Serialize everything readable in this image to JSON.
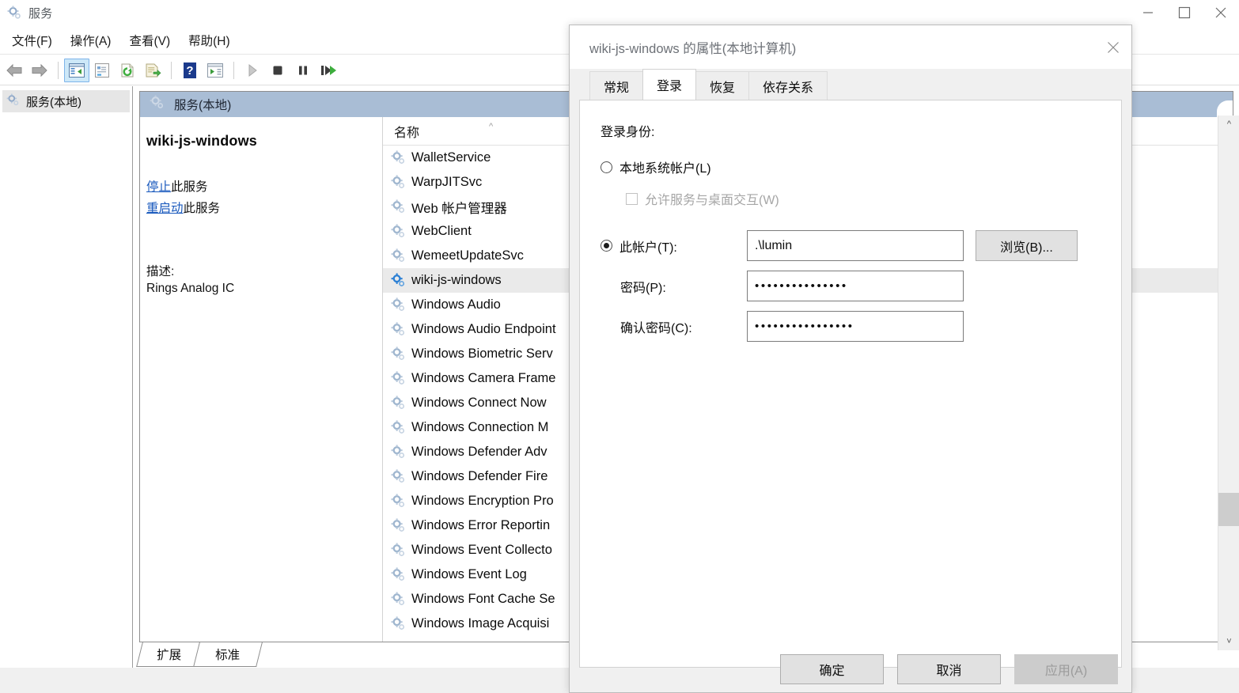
{
  "window": {
    "title": "服务",
    "icon": "services-gear-icon",
    "controls": {
      "minimize": "minimize-icon",
      "maximize": "maximize-icon",
      "close": "close-icon"
    }
  },
  "menubar": {
    "items": [
      {
        "label": "文件(F)",
        "name": "menu-file"
      },
      {
        "label": "操作(A)",
        "name": "menu-action"
      },
      {
        "label": "查看(V)",
        "name": "menu-view"
      },
      {
        "label": "帮助(H)",
        "name": "menu-help"
      }
    ]
  },
  "toolbar": {
    "buttons": [
      {
        "name": "back-icon"
      },
      {
        "name": "forward-icon"
      },
      {
        "name": "show-hide-console-tree-icon"
      },
      {
        "name": "properties-icon"
      },
      {
        "name": "refresh-icon"
      },
      {
        "name": "export-list-icon"
      },
      {
        "name": "help-icon"
      },
      {
        "name": "show-hide-action-pane-icon"
      },
      {
        "name": "start-service-icon"
      },
      {
        "name": "stop-service-icon"
      },
      {
        "name": "pause-service-icon"
      },
      {
        "name": "restart-service-icon"
      }
    ]
  },
  "tree": {
    "root_label": "服务(本地)"
  },
  "pane": {
    "header_title": "服务(本地)"
  },
  "detail": {
    "service_name": "wiki-js-windows",
    "stop_link": "停止",
    "stop_suffix": "此服务",
    "restart_link": "重启动",
    "restart_suffix": "此服务",
    "description_label": "描述:",
    "description_text": "Rings Analog IC"
  },
  "list": {
    "column_header": "名称",
    "sort_indicator": "ascending",
    "rows": [
      {
        "label": "WalletService",
        "selected": false
      },
      {
        "label": "WarpJITSvc",
        "selected": false
      },
      {
        "label": "Web 帐户管理器",
        "selected": false
      },
      {
        "label": "WebClient",
        "selected": false
      },
      {
        "label": "WemeetUpdateSvc",
        "selected": false
      },
      {
        "label": "wiki-js-windows",
        "selected": true
      },
      {
        "label": "Windows Audio",
        "selected": false
      },
      {
        "label": "Windows Audio Endpoint",
        "selected": false
      },
      {
        "label": "Windows Biometric Serv",
        "selected": false
      },
      {
        "label": "Windows Camera Frame",
        "selected": false
      },
      {
        "label": "Windows Connect Now",
        "selected": false
      },
      {
        "label": "Windows Connection M",
        "selected": false
      },
      {
        "label": "Windows Defender Adv",
        "selected": false
      },
      {
        "label": "Windows Defender Fire",
        "selected": false
      },
      {
        "label": "Windows Encryption Pro",
        "selected": false
      },
      {
        "label": "Windows Error Reportin",
        "selected": false
      },
      {
        "label": "Windows Event Collecto",
        "selected": false
      },
      {
        "label": "Windows Event Log",
        "selected": false
      },
      {
        "label": "Windows Font Cache Se",
        "selected": false
      },
      {
        "label": "Windows Image Acquisi",
        "selected": false
      }
    ]
  },
  "bottom_tabs": [
    {
      "label": "扩展",
      "name": "tab-extended"
    },
    {
      "label": "标准",
      "name": "tab-standard"
    }
  ],
  "dialog": {
    "title": "wiki-js-windows 的属性(本地计算机)",
    "close_icon": "close-icon",
    "tabs": [
      {
        "label": "常规",
        "name": "tab-general",
        "active": false
      },
      {
        "label": "登录",
        "name": "tab-logon",
        "active": true
      },
      {
        "label": "恢复",
        "name": "tab-recovery",
        "active": false
      },
      {
        "label": "依存关系",
        "name": "tab-dependencies",
        "active": false
      }
    ],
    "logon": {
      "section_label": "登录身份:",
      "local_system_label": "本地系统帐户(L)",
      "local_system_selected": false,
      "allow_desktop_label": "允许服务与桌面交互(W)",
      "allow_desktop_checked": false,
      "allow_desktop_disabled": true,
      "this_account_label": "此帐户(T):",
      "this_account_selected": true,
      "account_value": ".\\lumin",
      "browse_label": "浏览(B)...",
      "password_label": "密码(P):",
      "password_value": "•••••••••••••••",
      "confirm_label": "确认密码(C):",
      "confirm_value": "••••••••••••••••"
    },
    "buttons": [
      {
        "label": "确定",
        "name": "ok-button",
        "disabled": false
      },
      {
        "label": "取消",
        "name": "cancel-button",
        "disabled": false
      },
      {
        "label": "应用(A)",
        "name": "apply-button",
        "disabled": true
      }
    ]
  },
  "colors": {
    "pane_header": "#a9bdd5",
    "link": "#1959bd",
    "selection": "#eaeaea",
    "toolbar_selected": "#cde8f8"
  }
}
